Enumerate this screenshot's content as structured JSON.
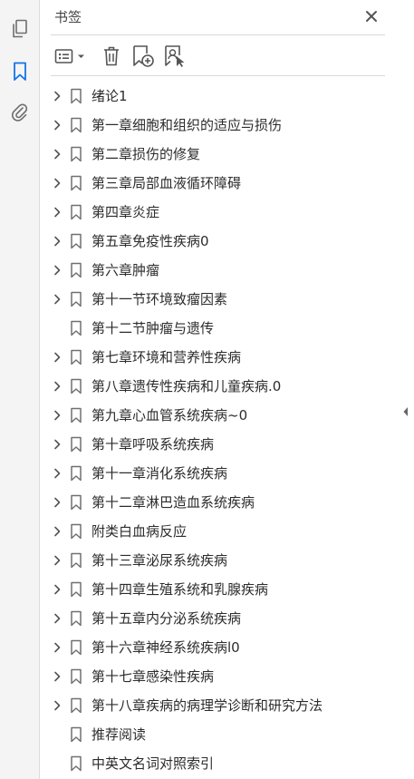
{
  "panel": {
    "title": "书签"
  },
  "rail": {
    "icons": [
      "pages-icon",
      "bookmark-icon",
      "attachment-icon"
    ],
    "active": "bookmark-icon",
    "accent": "#1473e6"
  },
  "toolbar": {
    "icons": [
      "options-menu-icon",
      "delete-bookmark-icon",
      "new-bookmark-icon",
      "bookmark-from-selection-icon"
    ]
  },
  "bookmarks": [
    {
      "label": "绪论1",
      "expandable": true
    },
    {
      "label": "第一章细胞和组织的适应与损伤",
      "expandable": true
    },
    {
      "label": "第二章损伤的修复",
      "expandable": true
    },
    {
      "label": "第三章局部血液循环障碍",
      "expandable": true
    },
    {
      "label": "第四章炎症",
      "expandable": true
    },
    {
      "label": "第五章免疫性疾病0",
      "expandable": true
    },
    {
      "label": "第六章肿瘤",
      "expandable": true
    },
    {
      "label": "第十一节环境致瘤因素",
      "expandable": true
    },
    {
      "label": "第十二节肿瘤与遗传",
      "expandable": false
    },
    {
      "label": "第七章环境和营养性疾病",
      "expandable": true
    },
    {
      "label": "第八章遗传性疾病和儿童疾病.0",
      "expandable": true
    },
    {
      "label": "第九章心血管系统疾病~0",
      "expandable": true
    },
    {
      "label": "第十章呼吸系统疾病",
      "expandable": true
    },
    {
      "label": "第十一章消化系统疾病",
      "expandable": true
    },
    {
      "label": "第十二章淋巴造血系统疾病",
      "expandable": true
    },
    {
      "label": "附类白血病反应",
      "expandable": true
    },
    {
      "label": "第十三章泌尿系统疾病",
      "expandable": true
    },
    {
      "label": "第十四章生殖系统和乳腺疾病",
      "expandable": true
    },
    {
      "label": "第十五章内分泌系统疾病",
      "expandable": true
    },
    {
      "label": "第十六章神经系统疾病l0",
      "expandable": true
    },
    {
      "label": "第十七章感染性疾病",
      "expandable": true
    },
    {
      "label": "第十八章疾病的病理学诊断和研究方法",
      "expandable": true
    },
    {
      "label": "推荐阅读",
      "expandable": false
    },
    {
      "label": "中英文名词对照索引",
      "expandable": false
    }
  ]
}
